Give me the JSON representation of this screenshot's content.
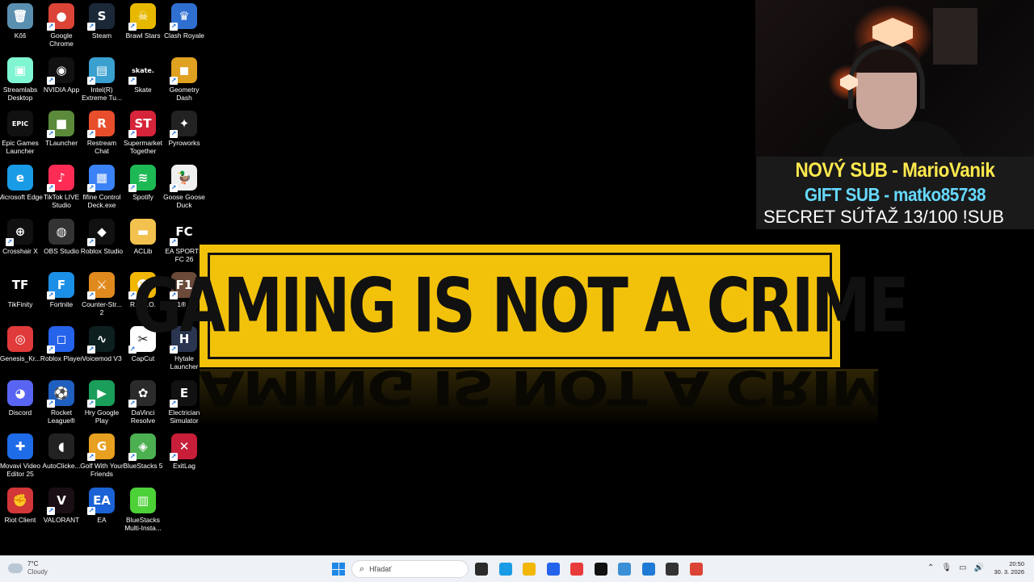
{
  "desktop": {
    "icons": [
      {
        "label": "Kôš",
        "color": "#5b8fb0",
        "glyph": "🗑",
        "shortcut": false,
        "col": 0,
        "row": 0
      },
      {
        "label": "Google Chrome",
        "color": "#db4437",
        "glyph": "●",
        "shortcut": true,
        "col": 1,
        "row": 0
      },
      {
        "label": "Steam",
        "color": "#1b2838",
        "glyph": "S",
        "shortcut": true,
        "col": 2,
        "row": 0
      },
      {
        "label": "Brawl Stars",
        "color": "#e6b800",
        "glyph": "☠",
        "shortcut": true,
        "col": 3,
        "row": 0
      },
      {
        "label": "Clash Royale",
        "color": "#2f6fd0",
        "glyph": "♛",
        "shortcut": true,
        "col": 4,
        "row": 0
      },
      {
        "label": "Streamlabs Desktop",
        "color": "#80f5d2",
        "glyph": "▣",
        "shortcut": false,
        "col": 0,
        "row": 1
      },
      {
        "label": "NVIDIA App",
        "color": "#111111",
        "glyph": "◉",
        "shortcut": true,
        "col": 1,
        "row": 1
      },
      {
        "label": "Intel(R) Extreme Tu...",
        "color": "#3aa0d0",
        "glyph": "▤",
        "shortcut": true,
        "col": 2,
        "row": 1
      },
      {
        "label": "Skate",
        "color": "#000000",
        "glyph": "skate.",
        "shortcut": true,
        "col": 3,
        "row": 1
      },
      {
        "label": "Geometry Dash",
        "color": "#e0a020",
        "glyph": "◼",
        "shortcut": true,
        "col": 4,
        "row": 1
      },
      {
        "label": "Epic Games Launcher",
        "color": "#111111",
        "glyph": "EPIC",
        "shortcut": false,
        "col": 0,
        "row": 2
      },
      {
        "label": "TLauncher",
        "color": "#5a8a3a",
        "glyph": "■",
        "shortcut": true,
        "col": 1,
        "row": 2
      },
      {
        "label": "Restream Chat",
        "color": "#e84e2c",
        "glyph": "R",
        "shortcut": true,
        "col": 2,
        "row": 2
      },
      {
        "label": "Supermarket Together",
        "color": "#d6243a",
        "glyph": "ST",
        "shortcut": true,
        "col": 3,
        "row": 2
      },
      {
        "label": "Pyroworks",
        "color": "#222222",
        "glyph": "✦",
        "shortcut": true,
        "col": 4,
        "row": 2
      },
      {
        "label": "Microsoft Edge",
        "color": "#1a9be6",
        "glyph": "e",
        "shortcut": false,
        "col": 0,
        "row": 3
      },
      {
        "label": "TikTok LIVE Studio",
        "color": "#fe2c55",
        "glyph": "♪",
        "shortcut": true,
        "col": 1,
        "row": 3
      },
      {
        "label": "fifine Control Deck.exe",
        "color": "#3b82f6",
        "glyph": "▦",
        "shortcut": true,
        "col": 2,
        "row": 3
      },
      {
        "label": "Spotify",
        "color": "#1db954",
        "glyph": "≋",
        "shortcut": true,
        "col": 3,
        "row": 3
      },
      {
        "label": "Goose Goose Duck",
        "color": "#f0f0f0",
        "glyph": "🦆",
        "shortcut": true,
        "col": 4,
        "row": 3
      },
      {
        "label": "Crosshair X",
        "color": "#111111",
        "glyph": "⊕",
        "shortcut": true,
        "col": 0,
        "row": 4
      },
      {
        "label": "OBS Studio",
        "color": "#333333",
        "glyph": "◍",
        "shortcut": false,
        "col": 1,
        "row": 4
      },
      {
        "label": "Roblox Studio",
        "color": "#111111",
        "glyph": "◆",
        "shortcut": true,
        "col": 2,
        "row": 4
      },
      {
        "label": "ACLib",
        "color": "#f2c14e",
        "glyph": "▬",
        "shortcut": false,
        "col": 3,
        "row": 4
      },
      {
        "label": "EA SPORTS FC 26",
        "color": "#000000",
        "glyph": "FC",
        "shortcut": true,
        "col": 4,
        "row": 4
      },
      {
        "label": "TikFinity",
        "color": "#000000",
        "glyph": "TF",
        "shortcut": false,
        "col": 0,
        "row": 5
      },
      {
        "label": "Fortnite",
        "color": "#1b8fe6",
        "glyph": "F",
        "shortcut": true,
        "col": 1,
        "row": 5
      },
      {
        "label": "Counter-Str... 2",
        "color": "#e08a1e",
        "glyph": "⚔",
        "shortcut": true,
        "col": 2,
        "row": 5
      },
      {
        "label": "R.E.P.O.",
        "color": "#f2b705",
        "glyph": "☻",
        "shortcut": true,
        "col": 3,
        "row": 5
      },
      {
        "label": "F1® 25",
        "color": "#6b4a3a",
        "glyph": "F1",
        "shortcut": true,
        "col": 4,
        "row": 5
      },
      {
        "label": "Genesis_Kr...",
        "color": "#e03a3a",
        "glyph": "◎",
        "shortcut": false,
        "col": 0,
        "row": 6
      },
      {
        "label": "Roblox Player",
        "color": "#2563eb",
        "glyph": "◻",
        "shortcut": true,
        "col": 1,
        "row": 6
      },
      {
        "label": "Voicemod V3",
        "color": "#0d1f1f",
        "glyph": "∿",
        "shortcut": true,
        "col": 2,
        "row": 6
      },
      {
        "label": "CapCut",
        "color": "#ffffff",
        "glyph": "✂",
        "shortcut": true,
        "col": 3,
        "row": 6
      },
      {
        "label": "Hytale Launcher",
        "color": "#2a3550",
        "glyph": "H",
        "shortcut": true,
        "col": 4,
        "row": 6
      },
      {
        "label": "Discord",
        "color": "#5865f2",
        "glyph": "◕",
        "shortcut": false,
        "col": 0,
        "row": 7
      },
      {
        "label": "Rocket League®",
        "color": "#1f5fbf",
        "glyph": "⚽",
        "shortcut": true,
        "col": 1,
        "row": 7
      },
      {
        "label": "Hry Google Play",
        "color": "#1a9e5a",
        "glyph": "▶",
        "shortcut": true,
        "col": 2,
        "row": 7
      },
      {
        "label": "DaVinci Resolve",
        "color": "#2b2b2b",
        "glyph": "✿",
        "shortcut": true,
        "col": 3,
        "row": 7
      },
      {
        "label": "Electrician Simulator",
        "color": "#111111",
        "glyph": "E",
        "shortcut": true,
        "col": 4,
        "row": 7
      },
      {
        "label": "Movavi Video Editor 25",
        "color": "#1e6ce8",
        "glyph": "✚",
        "shortcut": false,
        "col": 0,
        "row": 8
      },
      {
        "label": "AutoClicke...",
        "color": "#222222",
        "glyph": "◖",
        "shortcut": false,
        "col": 1,
        "row": 8
      },
      {
        "label": "Golf With Your Friends",
        "color": "#e8a020",
        "glyph": "G",
        "shortcut": true,
        "col": 2,
        "row": 8
      },
      {
        "label": "BlueStacks 5",
        "color": "#4caf50",
        "glyph": "◈",
        "shortcut": true,
        "col": 3,
        "row": 8
      },
      {
        "label": "ExitLag",
        "color": "#c81e3a",
        "glyph": "✕",
        "shortcut": true,
        "col": 4,
        "row": 8
      },
      {
        "label": "Riot Client",
        "color": "#d13639",
        "glyph": "✊",
        "shortcut": false,
        "col": 0,
        "row": 9
      },
      {
        "label": "VALORANT",
        "color": "#1a0f14",
        "glyph": "V",
        "shortcut": true,
        "col": 1,
        "row": 9
      },
      {
        "label": "EA",
        "color": "#1b62d6",
        "glyph": "EA",
        "shortcut": true,
        "col": 2,
        "row": 9
      },
      {
        "label": "BlueStacks Multi-Insta...",
        "color": "#4cd137",
        "glyph": "▥",
        "shortcut": false,
        "col": 3,
        "row": 9
      }
    ]
  },
  "wallpaper": {
    "banner_text": "GAMING IS NOT A CRIME"
  },
  "overlay": {
    "line1": "NOVÝ SUB - MarioVanik",
    "line2": "GIFT SUB - matko85738",
    "line3": "SECRET SÚŤAŽ  13/100 !SUB"
  },
  "taskbar": {
    "weather_temp": "7°C",
    "weather_cond": "Cloudy",
    "search_placeholder": "Hľadať",
    "apps": [
      {
        "name": "taskview",
        "color": "#2b2b2b"
      },
      {
        "name": "edge",
        "color": "#1a9be6"
      },
      {
        "name": "explorer",
        "color": "#f2b705"
      },
      {
        "name": "store",
        "color": "#2563eb"
      },
      {
        "name": "app-red",
        "color": "#e83b3b"
      },
      {
        "name": "tiktok",
        "color": "#111111"
      },
      {
        "name": "notepad",
        "color": "#3a8fd6"
      },
      {
        "name": "photos",
        "color": "#1f7ad6"
      },
      {
        "name": "obs",
        "color": "#333333"
      },
      {
        "name": "chrome",
        "color": "#db4437"
      }
    ],
    "time": "20:50",
    "date": "30. 3. 2026"
  }
}
